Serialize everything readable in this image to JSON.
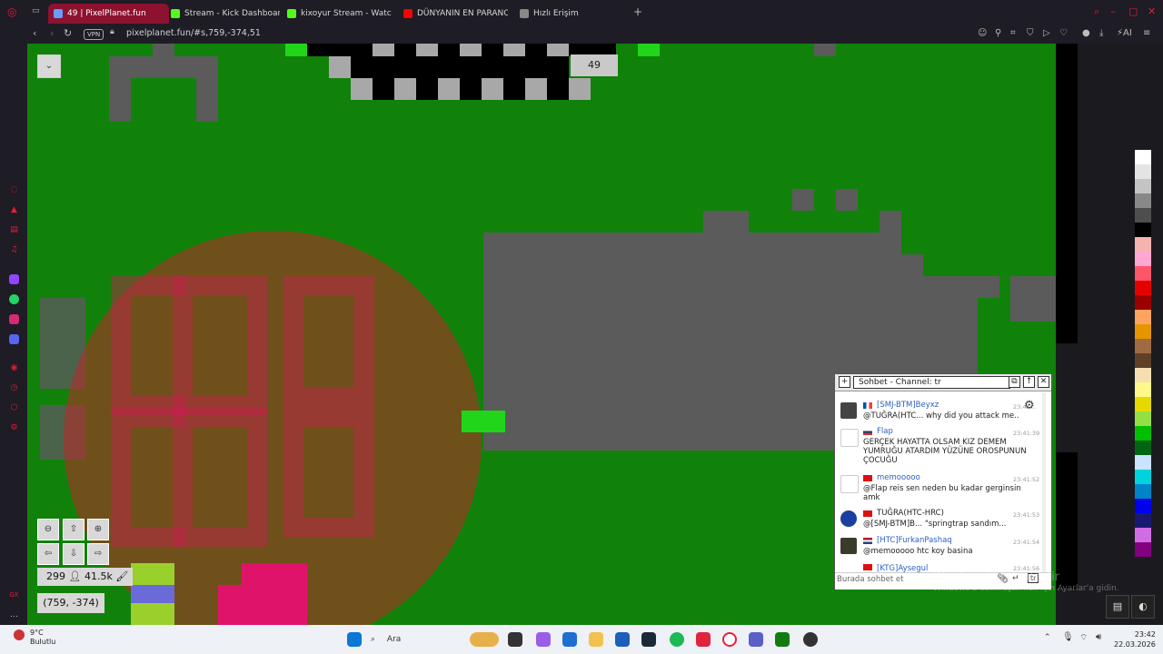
{
  "browser": {
    "tabs": [
      {
        "label": "49 | PixelPlanet.fun",
        "active": true,
        "color": "#8d1230"
      },
      {
        "label": "Stream - Kick Dashboard",
        "active": false,
        "color": "#53fc18"
      },
      {
        "label": "kixoyur Stream - Watch L",
        "active": false,
        "color": "#53fc18"
      },
      {
        "label": "DÜNYANIN EN PARANOR",
        "active": false,
        "color": "#ff0000"
      },
      {
        "label": "Hızlı Erişim",
        "active": false,
        "color": "#888888"
      }
    ],
    "vpn_label": "VPN",
    "url": "pixelplanet.fun/#s,759,-374,51",
    "ai_label": "AI"
  },
  "canvas": {
    "online_users": "299",
    "pixel_count": "41.5k",
    "coordinates": "(759, -374)",
    "cooldown_counter": "49"
  },
  "chat": {
    "title": "Sohbet - Channel: tr",
    "input_placeholder": "Burada sohbet et",
    "channel_button": "tr",
    "messages": [
      {
        "user": "[SMJ-BTM]Beyxz",
        "time": "23:41:..",
        "text": "@TUĞRA(HTC... why did you attack me..",
        "mention": "@TUĞRA(HTC..."
      },
      {
        "user": "Flap",
        "time": "23:41:39",
        "text": "GERÇEK HAYATTA OLSAM KIZ DEMEM YUMRUĞU ATARDIM YÜZÜNE OROSPUNUN ÇOCUĞU"
      },
      {
        "user": "memooooo",
        "time": "23:41:52",
        "text": "@Flap reis sen neden bu kadar gerginsin amk"
      },
      {
        "user": "TUĞRA(HTC-HRC)",
        "time": "23:41:53",
        "text": "@[SMJ-BTM]B... \"springtrap sandım..."
      },
      {
        "user": "[HTC]FurkanPashaq",
        "time": "23:41:54",
        "text": "@memooooo htc koy basina"
      },
      {
        "user": "[KTG]Aysegul",
        "time": "23:41:56",
        "text": ""
      }
    ]
  },
  "watermark": {
    "line1": "Windows'u Etkinleştir",
    "line2": "Windows'u etkinleştirmek için Ayarlar'a gidin."
  },
  "taskbar": {
    "weather_temp": "9°C",
    "weather_desc": "Bulutlu",
    "search_placeholder": "Ara",
    "time": "23:42",
    "date": "22.03.2026"
  },
  "palette": [
    "#ffffff",
    "#e4e4e4",
    "#c4c4c4",
    "#888888",
    "#4e4e4e",
    "#000000",
    "#f4b3ae",
    "#ffa7d1",
    "#ff5569",
    "#e50000",
    "#9a0000",
    "#fea460",
    "#e59500",
    "#a06a42",
    "#604028",
    "#f5dfb0",
    "#fff889",
    "#e5d900",
    "#94e044",
    "#02be01",
    "#006513",
    "#cae3ff",
    "#00d3dd",
    "#0083c7",
    "#0000ea",
    "#191973",
    "#cf6ee4",
    "#820080"
  ]
}
